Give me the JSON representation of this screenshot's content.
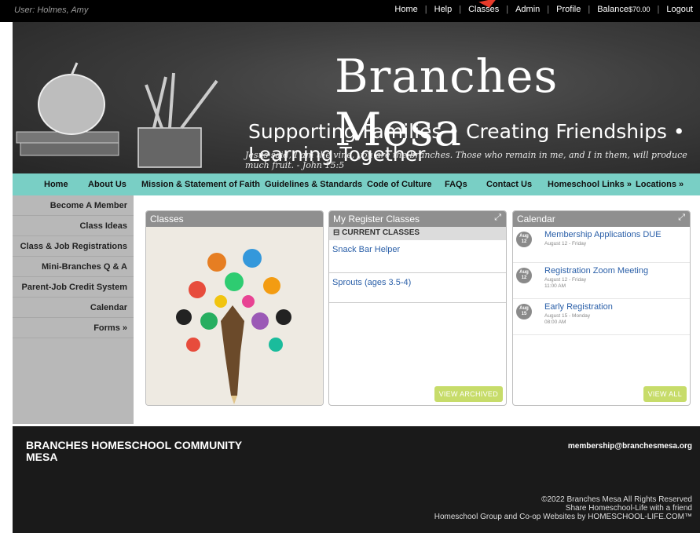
{
  "topbar": {
    "user": "User: Holmes, Amy",
    "links": [
      "Home",
      "Help",
      "Classes",
      "Admin",
      "Profile"
    ],
    "balance_label": "Balance",
    "balance_value": "$70.00",
    "logout": "Logout"
  },
  "banner": {
    "title": "Branches Mesa",
    "tagline": "Supporting Families • Creating Friendships • Learning Together",
    "verse": "Jesus said, I am the vine, you are the branches. Those who remain in me, and I in them, will produce much fruit. - John 15:5"
  },
  "mainnav": {
    "items": [
      "Home",
      "About Us",
      "Mission & Statement of Faith",
      "Guidelines & Standards",
      "Code of Culture",
      "FAQs",
      "Contact Us",
      "Homeschool Links »",
      "Locations »"
    ]
  },
  "sidebar": {
    "items": [
      "Become A Member",
      "Class Ideas",
      "Class & Job Registrations",
      "Mini-Branches Q & A",
      "Parent-Job Credit System",
      "Calendar",
      "Forms »"
    ]
  },
  "panels": {
    "classes": {
      "title": "Classes"
    },
    "register": {
      "title": "My Register Classes",
      "subhead": "CURRENT CLASSES",
      "items": [
        "Snack Bar Helper",
        "Sprouts (ages 3.5-4)"
      ],
      "button": "VIEW ARCHIVED"
    },
    "calendar": {
      "title": "Calendar",
      "events": [
        {
          "month": "Aug",
          "day": "12",
          "title": "Membership Applications DUE",
          "date": "August 12 - Friday",
          "time": ""
        },
        {
          "month": "Aug",
          "day": "12",
          "title": "Registration Zoom Meeting",
          "date": "August 12 - Friday",
          "time": "11:00 AM"
        },
        {
          "month": "Aug",
          "day": "15",
          "title": "Early Registration",
          "date": "August 15 - Monday",
          "time": "08:00 AM"
        }
      ],
      "button": "VIEW ALL"
    }
  },
  "footer": {
    "org": "BRANCHES HOMESCHOOL COMMUNITY MESA",
    "email": "membership@branchesmesa.org",
    "copyright": "©2022 Branches Mesa All Rights Reserved",
    "share": "Share Homeschool-Life with a friend",
    "powered": "Homeschool Group and Co-op Websites by HOMESCHOOL-LIFE.COM™"
  },
  "colors": {
    "nav": "#79cfc5",
    "sidebar": "#b8b8b8",
    "button": "#c7dc6a",
    "link": "#2a5fa8"
  }
}
